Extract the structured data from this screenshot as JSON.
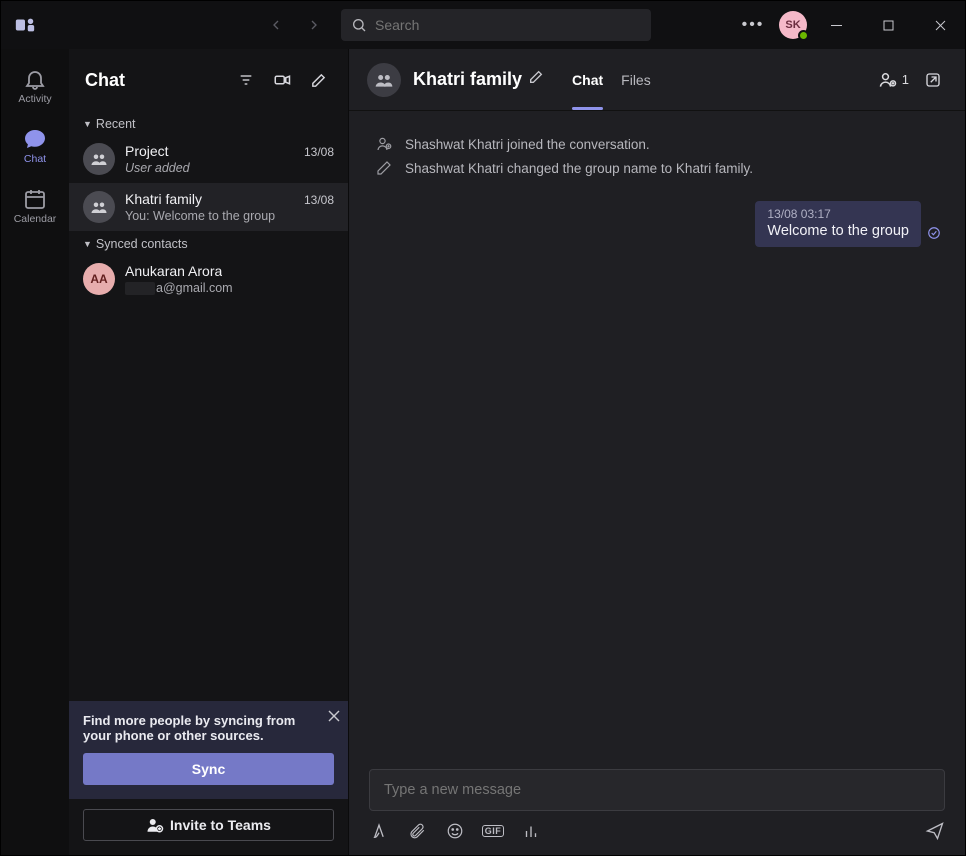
{
  "search": {
    "placeholder": "Search"
  },
  "profile": {
    "initials": "SK"
  },
  "rail": {
    "activity": "Activity",
    "chat": "Chat",
    "calendar": "Calendar"
  },
  "list": {
    "title": "Chat",
    "sections": {
      "recent": "Recent",
      "synced": "Synced contacts"
    },
    "items": [
      {
        "name": "Project",
        "date": "13/08",
        "preview": "User added"
      },
      {
        "name": "Khatri family",
        "date": "13/08",
        "preview": "You: Welcome to the group"
      }
    ],
    "contacts": [
      {
        "name": "Anukaran Arora",
        "initials": "AA",
        "email_suffix": "a@gmail.com"
      }
    ]
  },
  "syncPrompt": {
    "message": "Find more people by syncing from your phone or other sources.",
    "sync": "Sync",
    "invite": "Invite to Teams"
  },
  "chat": {
    "title": "Khatri family",
    "tabs": {
      "chat": "Chat",
      "files": "Files"
    },
    "participants": "1",
    "system": [
      "Shashwat Khatri joined the conversation.",
      "Shashwat Khatri changed the group name to Khatri family."
    ],
    "messages": [
      {
        "ts": "13/08 03:17",
        "body": "Welcome to the group"
      }
    ],
    "composer": {
      "placeholder": "Type a new message"
    },
    "gif_label": "GIF"
  }
}
